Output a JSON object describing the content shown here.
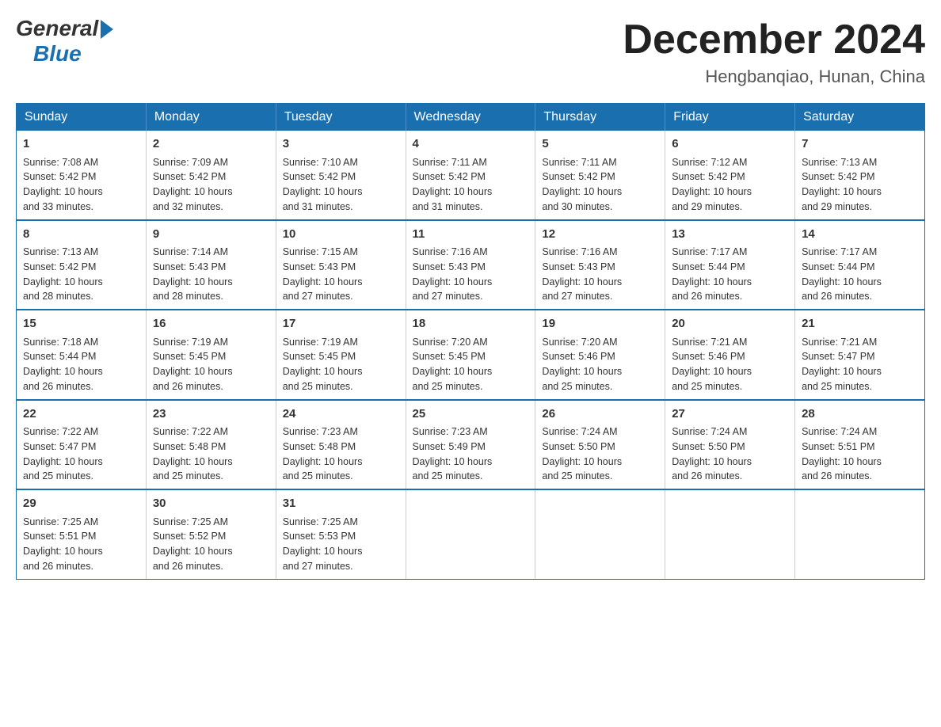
{
  "logo": {
    "general": "General",
    "blue": "Blue"
  },
  "title": "December 2024",
  "location": "Hengbanqiao, Hunan, China",
  "headers": [
    "Sunday",
    "Monday",
    "Tuesday",
    "Wednesday",
    "Thursday",
    "Friday",
    "Saturday"
  ],
  "weeks": [
    [
      {
        "day": "1",
        "info": "Sunrise: 7:08 AM\nSunset: 5:42 PM\nDaylight: 10 hours\nand 33 minutes."
      },
      {
        "day": "2",
        "info": "Sunrise: 7:09 AM\nSunset: 5:42 PM\nDaylight: 10 hours\nand 32 minutes."
      },
      {
        "day": "3",
        "info": "Sunrise: 7:10 AM\nSunset: 5:42 PM\nDaylight: 10 hours\nand 31 minutes."
      },
      {
        "day": "4",
        "info": "Sunrise: 7:11 AM\nSunset: 5:42 PM\nDaylight: 10 hours\nand 31 minutes."
      },
      {
        "day": "5",
        "info": "Sunrise: 7:11 AM\nSunset: 5:42 PM\nDaylight: 10 hours\nand 30 minutes."
      },
      {
        "day": "6",
        "info": "Sunrise: 7:12 AM\nSunset: 5:42 PM\nDaylight: 10 hours\nand 29 minutes."
      },
      {
        "day": "7",
        "info": "Sunrise: 7:13 AM\nSunset: 5:42 PM\nDaylight: 10 hours\nand 29 minutes."
      }
    ],
    [
      {
        "day": "8",
        "info": "Sunrise: 7:13 AM\nSunset: 5:42 PM\nDaylight: 10 hours\nand 28 minutes."
      },
      {
        "day": "9",
        "info": "Sunrise: 7:14 AM\nSunset: 5:43 PM\nDaylight: 10 hours\nand 28 minutes."
      },
      {
        "day": "10",
        "info": "Sunrise: 7:15 AM\nSunset: 5:43 PM\nDaylight: 10 hours\nand 27 minutes."
      },
      {
        "day": "11",
        "info": "Sunrise: 7:16 AM\nSunset: 5:43 PM\nDaylight: 10 hours\nand 27 minutes."
      },
      {
        "day": "12",
        "info": "Sunrise: 7:16 AM\nSunset: 5:43 PM\nDaylight: 10 hours\nand 27 minutes."
      },
      {
        "day": "13",
        "info": "Sunrise: 7:17 AM\nSunset: 5:44 PM\nDaylight: 10 hours\nand 26 minutes."
      },
      {
        "day": "14",
        "info": "Sunrise: 7:17 AM\nSunset: 5:44 PM\nDaylight: 10 hours\nand 26 minutes."
      }
    ],
    [
      {
        "day": "15",
        "info": "Sunrise: 7:18 AM\nSunset: 5:44 PM\nDaylight: 10 hours\nand 26 minutes."
      },
      {
        "day": "16",
        "info": "Sunrise: 7:19 AM\nSunset: 5:45 PM\nDaylight: 10 hours\nand 26 minutes."
      },
      {
        "day": "17",
        "info": "Sunrise: 7:19 AM\nSunset: 5:45 PM\nDaylight: 10 hours\nand 25 minutes."
      },
      {
        "day": "18",
        "info": "Sunrise: 7:20 AM\nSunset: 5:45 PM\nDaylight: 10 hours\nand 25 minutes."
      },
      {
        "day": "19",
        "info": "Sunrise: 7:20 AM\nSunset: 5:46 PM\nDaylight: 10 hours\nand 25 minutes."
      },
      {
        "day": "20",
        "info": "Sunrise: 7:21 AM\nSunset: 5:46 PM\nDaylight: 10 hours\nand 25 minutes."
      },
      {
        "day": "21",
        "info": "Sunrise: 7:21 AM\nSunset: 5:47 PM\nDaylight: 10 hours\nand 25 minutes."
      }
    ],
    [
      {
        "day": "22",
        "info": "Sunrise: 7:22 AM\nSunset: 5:47 PM\nDaylight: 10 hours\nand 25 minutes."
      },
      {
        "day": "23",
        "info": "Sunrise: 7:22 AM\nSunset: 5:48 PM\nDaylight: 10 hours\nand 25 minutes."
      },
      {
        "day": "24",
        "info": "Sunrise: 7:23 AM\nSunset: 5:48 PM\nDaylight: 10 hours\nand 25 minutes."
      },
      {
        "day": "25",
        "info": "Sunrise: 7:23 AM\nSunset: 5:49 PM\nDaylight: 10 hours\nand 25 minutes."
      },
      {
        "day": "26",
        "info": "Sunrise: 7:24 AM\nSunset: 5:50 PM\nDaylight: 10 hours\nand 25 minutes."
      },
      {
        "day": "27",
        "info": "Sunrise: 7:24 AM\nSunset: 5:50 PM\nDaylight: 10 hours\nand 26 minutes."
      },
      {
        "day": "28",
        "info": "Sunrise: 7:24 AM\nSunset: 5:51 PM\nDaylight: 10 hours\nand 26 minutes."
      }
    ],
    [
      {
        "day": "29",
        "info": "Sunrise: 7:25 AM\nSunset: 5:51 PM\nDaylight: 10 hours\nand 26 minutes."
      },
      {
        "day": "30",
        "info": "Sunrise: 7:25 AM\nSunset: 5:52 PM\nDaylight: 10 hours\nand 26 minutes."
      },
      {
        "day": "31",
        "info": "Sunrise: 7:25 AM\nSunset: 5:53 PM\nDaylight: 10 hours\nand 27 minutes."
      },
      {
        "day": "",
        "info": ""
      },
      {
        "day": "",
        "info": ""
      },
      {
        "day": "",
        "info": ""
      },
      {
        "day": "",
        "info": ""
      }
    ]
  ]
}
